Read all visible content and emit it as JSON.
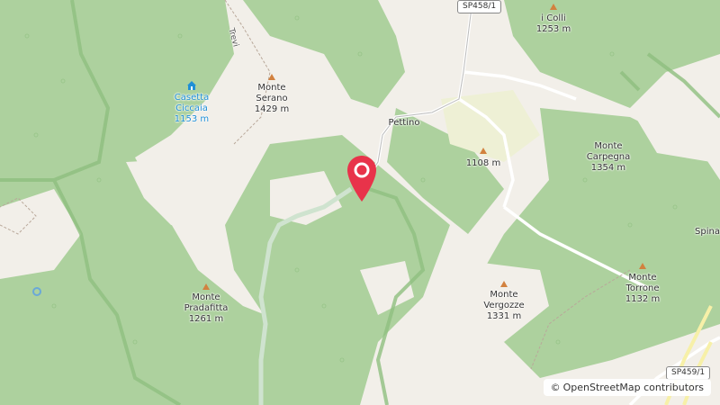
{
  "peaks": [
    {
      "name": "Monte",
      "name2": "Serano",
      "elev": "1429 m"
    },
    {
      "name": "i Colli",
      "elev": "1253 m"
    },
    {
      "name": "Monte",
      "name2": "Carpegna",
      "elev": "1354 m"
    },
    {
      "elev": "1108 m"
    },
    {
      "name": "Monte",
      "name2": "Pradafitta",
      "elev": "1261 m"
    },
    {
      "name": "Monte",
      "name2": "Vergozze",
      "elev": "1331 m"
    },
    {
      "name": "Monte",
      "name2": "Torrone",
      "elev": "1132 m"
    }
  ],
  "hut": {
    "line1": "Casetta",
    "line2": "Ciccaia",
    "elev": "1153 m"
  },
  "places": {
    "pettino": "Pettino",
    "spina": "Spina",
    "trevi": "Trevi"
  },
  "roads": {
    "sp458": "SP458/1",
    "sp459": "SP459/1"
  },
  "attribution": {
    "symbol": "©",
    "text": "OpenStreetMap contributors"
  },
  "colors": {
    "forest": "#add19e",
    "land": "#f2efe9",
    "road": "#ffffff",
    "marker": "#e8334a",
    "peak": "#d2813f",
    "water": "#1f8fd6"
  }
}
